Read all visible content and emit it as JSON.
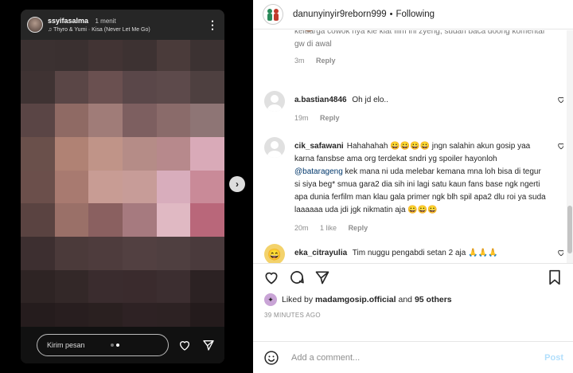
{
  "story": {
    "username": "ssyifasalma",
    "time": "1 menit",
    "song": "Thyro & Yumi · Kisa (Never Let Me Go)",
    "reply_placeholder": "Kirim pesan",
    "more_icon": "more-dots-icon",
    "next_icon": "chevron-right-icon",
    "mosaic_colors": [
      "#3b3131",
      "#3a3030",
      "#423434",
      "#3d3232",
      "#4a3b3a",
      "#3c3232",
      "#3f3333",
      "#5a4646",
      "#6a5050",
      "#5a4749",
      "#5d4a4b",
      "#4e4040",
      "#5a4545",
      "#8f6a64",
      "#a07c78",
      "#7d5f60",
      "#8a6b6a",
      "#8e7575",
      "#6a504b",
      "#b08274",
      "#c09488",
      "#b58c87",
      "#b7898c",
      "#d9aab8",
      "#6b4f4b",
      "#a87a70",
      "#c89c94",
      "#c79c98",
      "#d8adbc",
      "#c98a98",
      "#5a4341",
      "#9a7068",
      "#8a6060",
      "#a67a7f",
      "#e0b9c3",
      "#b9677a",
      "#3d2f30",
      "#4b3a3a",
      "#4e3c3d",
      "#524041",
      "#4f3f40",
      "#4a3a3c",
      "#2e2424",
      "#332828",
      "#3a2c2e",
      "#3a2b2d",
      "#3c2e30",
      "#2c2223",
      "#251c1d",
      "#281e1f",
      "#2a2020",
      "#2e2224",
      "#2d2223",
      "#241b1c"
    ]
  },
  "post": {
    "author": "danunyinyir9reborn999",
    "separator": "•",
    "follow_label": "Following"
  },
  "comments": [
    {
      "user": "",
      "text": "keluarga cowok nya kie kiat film ini zyeng, sudah baca doong komentar gw di awal",
      "time": "3m",
      "likes": "",
      "reply": "Reply",
      "avatar": "brown"
    },
    {
      "user": "a.bastian4846",
      "text": "Oh jd elo..",
      "time": "19m",
      "likes": "",
      "reply": "Reply",
      "avatar": "gray"
    },
    {
      "user": "cik_safawani",
      "text_before": "Hahahahah 😀😀😀😀 jngn salahin akun gosip yaa karna fansbse ama org terdekat sndri yg spoiler hayonloh ",
      "mention": "@batarageng",
      "text_after": " kek mana ni uda melebar kemana mna loh bisa di tegur si siya beg* smua gara2 dia sih ini lagi satu kaun fans base ngk ngerti apa dunia ferfilm man klau gala primer ngk blh spil apa2 dlu roi ya suda laaaaaa uda jdi jgk nikmatin aja 😀😀😀",
      "time": "20m",
      "likes": "1 like",
      "reply": "Reply",
      "avatar": "gray"
    },
    {
      "user": "eka_citrayulia",
      "text": "Tim nuggu pengabdi setan 2 aja 🙏🙏🙏",
      "avatar": "emoji",
      "avatar_glyph": "😄"
    }
  ],
  "likes": {
    "prefix": "Liked by",
    "user": "madamgosip.official",
    "middle": "and",
    "count": "95 others"
  },
  "timestamp": "39 MINUTES AGO",
  "add_comment": {
    "placeholder": "Add a comment...",
    "post_label": "Post"
  },
  "colors": {
    "link": "#00376b",
    "post_disabled": "#b2dffc"
  }
}
